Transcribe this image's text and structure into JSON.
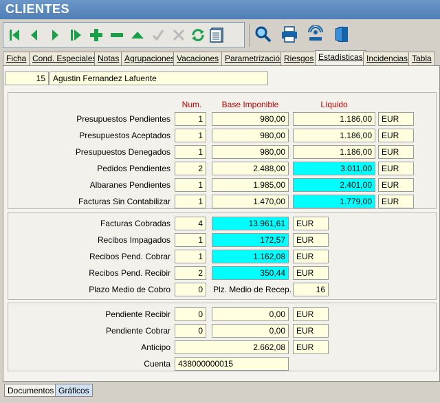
{
  "window": {
    "title": "CLIENTES"
  },
  "toolbar": {
    "buttons": [
      {
        "name": "first-record-icon"
      },
      {
        "name": "prev-record-icon"
      },
      {
        "name": "next-record-icon"
      },
      {
        "name": "last-record-icon"
      },
      {
        "name": "add-icon"
      },
      {
        "name": "delete-icon"
      },
      {
        "name": "up-icon"
      },
      {
        "name": "confirm-icon"
      },
      {
        "name": "cancel-icon"
      },
      {
        "name": "refresh-icon"
      },
      {
        "name": "list-icon"
      },
      {
        "name": "search-icon"
      },
      {
        "name": "print-icon"
      },
      {
        "name": "network-icon"
      },
      {
        "name": "exit-icon"
      }
    ]
  },
  "tabs": [
    "Ficha",
    "Cond. Especiales",
    "Notas",
    "Agrupaciones",
    "Vacaciones",
    "Parametrización",
    "Riesgos",
    "Estadísticas",
    "Incidencias",
    "Tabla"
  ],
  "active_tab": "Estadísticas",
  "client": {
    "code": "15",
    "name": "Agustin Fernandez Lafuente"
  },
  "headers": {
    "num": "Num.",
    "base": "Base Imponible",
    "liquido": "Líquido"
  },
  "section1": [
    {
      "label": "Presupuestos Pendientes",
      "num": "1",
      "base": "980,00",
      "liquido": "1.186,00",
      "currency": "EUR"
    },
    {
      "label": "Presupuestos Aceptados",
      "num": "1",
      "base": "980,00",
      "liquido": "1.186,00",
      "currency": "EUR"
    },
    {
      "label": "Presupuestos Denegados",
      "num": "1",
      "base": "980,00",
      "liquido": "1.186,00",
      "currency": "EUR"
    },
    {
      "label": "Pedidos Pendientes",
      "num": "2",
      "base": "2.488,00",
      "liquido": "3.011,00",
      "currency": "EUR"
    },
    {
      "label": "Albaranes Pendientes",
      "num": "1",
      "base": "1.985,00",
      "liquido": "2.401,00",
      "currency": "EUR"
    },
    {
      "label": "Facturas Sin Contabilizar",
      "num": "1",
      "base": "1.470,00",
      "liquido": "1.779,00",
      "currency": "EUR"
    }
  ],
  "section2": [
    {
      "label": "Facturas Cobradas",
      "num": "4",
      "amount": "13.961,61",
      "currency": "EUR"
    },
    {
      "label": "Recibos Impagados",
      "num": "1",
      "amount": "172,57",
      "currency": "EUR"
    },
    {
      "label": "Recibos Pend. Cobrar",
      "num": "1",
      "amount": "1.162,08",
      "currency": "EUR"
    },
    {
      "label": "Recibos Pend. Recibir",
      "num": "2",
      "amount": "350,44",
      "currency": "EUR"
    }
  ],
  "plazo": {
    "label": "Plazo  Medio de Cobro",
    "value": "0",
    "recep_label": "Plz. Medio de Recep.",
    "recep_value": "16"
  },
  "section3": [
    {
      "label": "Pendiente Recibir",
      "num": "0",
      "amount": "0,00",
      "currency": "EUR"
    },
    {
      "label": "Pendiente Cobrar",
      "num": "0",
      "amount": "0,00",
      "currency": "EUR"
    }
  ],
  "anticipo": {
    "label": "Anticipo",
    "amount": "2.662,08",
    "currency": "EUR"
  },
  "cuenta": {
    "label": "Cuenta",
    "value": "438000000015"
  },
  "bottom_tabs": [
    "Documentos",
    "Gráficos"
  ],
  "colors": {
    "field_bg": "#ffffe0",
    "highlight": "#00ffff",
    "header_red": "#c00000",
    "toolbar_green": "#1aa04a"
  }
}
